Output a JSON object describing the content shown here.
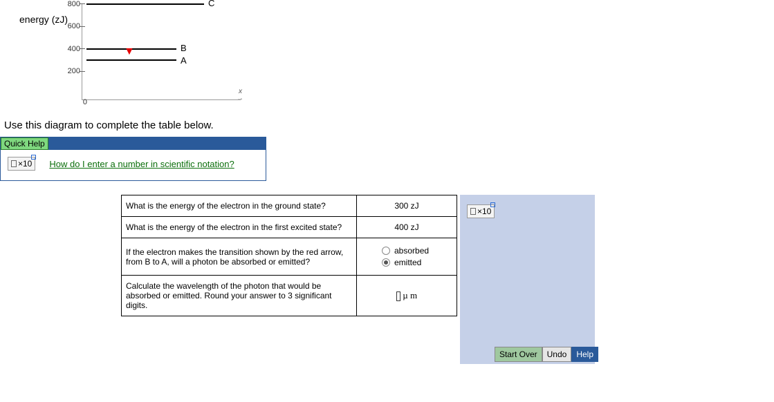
{
  "chart_data": {
    "type": "line",
    "title": "",
    "xlabel": "x",
    "ylabel": "energy (zJ)",
    "ylim": [
      0,
      800
    ],
    "yticks": [
      0,
      200,
      400,
      600,
      800
    ],
    "levels": [
      {
        "name": "A",
        "energy": 300
      },
      {
        "name": "B",
        "energy": 400
      },
      {
        "name": "C",
        "energy": 800
      }
    ],
    "transition": {
      "from": "B",
      "to": "A",
      "color": "red"
    }
  },
  "yLabel": "energy (zJ)",
  "ticks": {
    "t800": "800",
    "t600": "600",
    "t400": "400",
    "t200": "200",
    "t0": "0"
  },
  "levelLabels": {
    "A": "A",
    "B": "B",
    "C": "C"
  },
  "xLabel": "x",
  "instruction": "Use this diagram to complete the table below.",
  "quickHelp": {
    "tab": "Quick Help",
    "sci": "×10",
    "link": "How do I enter a number in scientific notation?"
  },
  "table": {
    "rows": [
      {
        "q": "What is the energy of the electron in the ground state?",
        "a": "300 zJ",
        "kind": "text"
      },
      {
        "q": "What is the energy of the electron in the first excited state?",
        "a": "400 zJ",
        "kind": "text"
      },
      {
        "q": "If the electron makes the transition shown by the red arrow, from B to A, will a photon be absorbed or emitted?",
        "kind": "radio"
      },
      {
        "q": "Calculate the wavelength of the photon that would be absorbed or emitted. Round your answer to 3 significant digits.",
        "kind": "input"
      }
    ],
    "radio": {
      "opt1": "absorbed",
      "opt2": "emitted",
      "selected": "emitted"
    },
    "inputUnit": "µ m"
  },
  "sciCell": "×10",
  "buttons": {
    "start": "Start Over",
    "undo": "Undo",
    "help": "Help"
  }
}
